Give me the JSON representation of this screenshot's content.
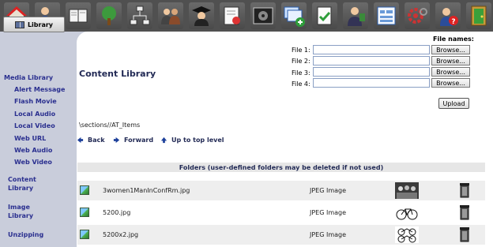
{
  "toolbar": {
    "icons": [
      "home-icon",
      "user-check-icon",
      "reading-icon",
      "tree-icon",
      "org-chart-icon",
      "people-icon",
      "graduate-icon",
      "certificate-icon",
      "film-icon",
      "add-window-icon",
      "document-check-icon",
      "teacher-icon",
      "form-icon",
      "settings-icon",
      "help-icon",
      "exit-door-icon"
    ]
  },
  "sidebar": {
    "library_button": "Library",
    "section_title": "Media Library",
    "items": [
      "Alert Message",
      "Flash Movie",
      "Local Audio",
      "Local Video",
      "Web URL",
      "Web Audio",
      "Web Video"
    ],
    "content_library": "Content Library",
    "image_library": "Image Library",
    "unzipping": "Unzipping"
  },
  "main": {
    "title": "Content Library",
    "file_names_header": "File names:",
    "file_fields": [
      {
        "label": "File 1:",
        "value": ""
      },
      {
        "label": "File 2:",
        "value": ""
      },
      {
        "label": "File 3:",
        "value": ""
      },
      {
        "label": "File 4:",
        "value": ""
      }
    ],
    "browse_label": "Browse...",
    "upload_label": "Upload",
    "path": "\\sections//AT_Items",
    "nav": {
      "back": "Back",
      "forward": "Forward",
      "up": "Up to top level"
    },
    "folders_header": "Folders (user-defined folders may be deleted if not used)",
    "files": [
      {
        "name": "3women1ManInConfRm.jpg",
        "type": "JPEG Image",
        "thumb": "meeting-photo"
      },
      {
        "name": "5200.jpg",
        "type": "JPEG Image",
        "thumb": "bicycle-photo"
      },
      {
        "name": "5200x2.jpg",
        "type": "JPEG Image",
        "thumb": "bicycle-pair-photo"
      }
    ]
  },
  "colors": {
    "toolbar_bg": "#505050",
    "sidebar_bg": "#c9cddb",
    "link_color": "#2a2f8f",
    "title_color": "#222a55"
  }
}
